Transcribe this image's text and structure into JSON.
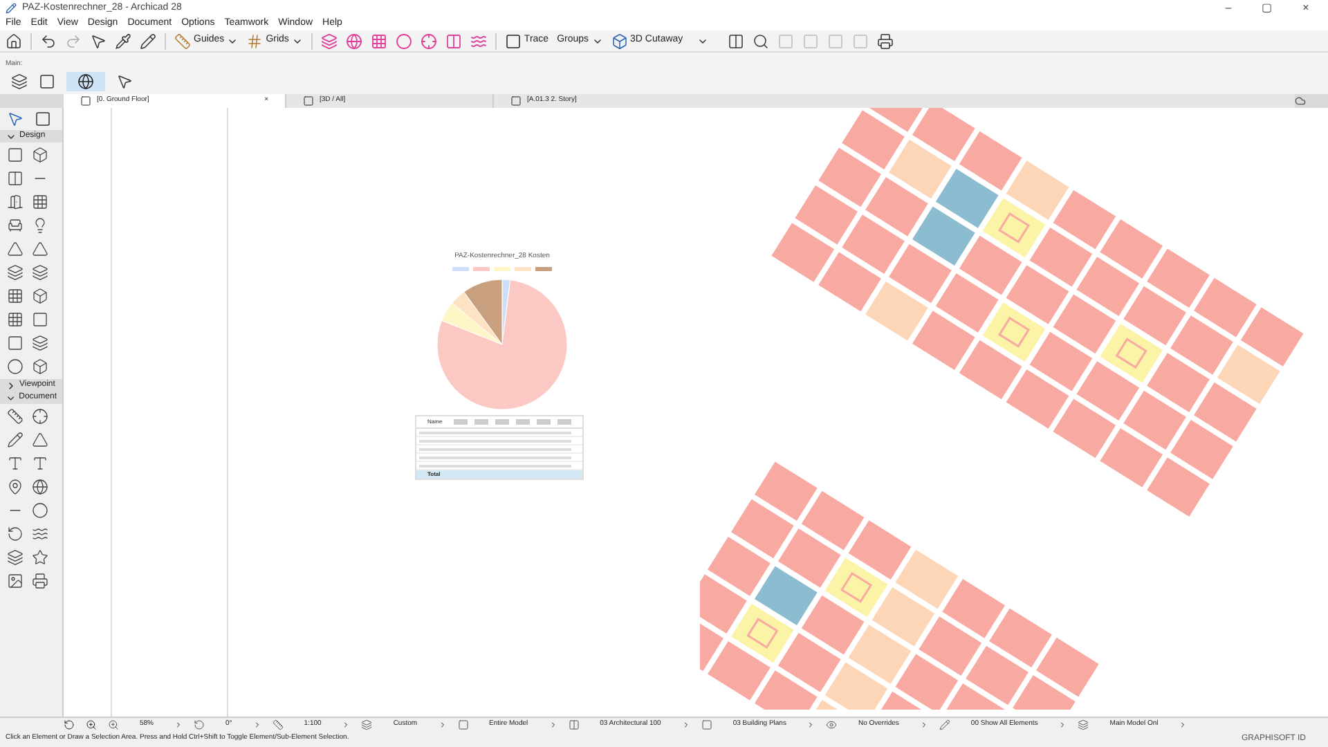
{
  "window": {
    "title": "PAZ-Kostenrechner_28 - Archicad 28",
    "controls": [
      "–",
      "▢",
      "×"
    ]
  },
  "menu": [
    "File",
    "Edit",
    "View",
    "Design",
    "Document",
    "Options",
    "Teamwork",
    "Window",
    "Help"
  ],
  "toolbar": {
    "dropdowns": [
      "Guides",
      "Grids",
      "Trace",
      "Groups",
      "3D Cutaway"
    ]
  },
  "main_label": "Main:",
  "tabs": [
    {
      "label": "[0. Ground Floor]",
      "selected": true,
      "close": "×"
    },
    {
      "label": "[3D / All]",
      "selected": false
    },
    {
      "label": "[A.01.3 2. Story]",
      "selected": false
    }
  ],
  "toolbox": {
    "sections": [
      {
        "title": "Design",
        "expanded": true
      },
      {
        "title": "Viewpoint",
        "expanded": false
      },
      {
        "title": "Document",
        "expanded": true
      }
    ]
  },
  "chart": {
    "title": "PAZ-Kostenrechner_28 Kosten"
  },
  "table": {
    "name_header": "Name",
    "total_label": "Total"
  },
  "status_bar": {
    "items": [
      "58%",
      "0°",
      "1:100",
      "Custom",
      "Entire Model",
      "03 Architectural 100",
      "03 Building Plans",
      "No Overrides",
      "00 Show All Elements",
      "Main Model Onl"
    ],
    "account": "GRAPHISOFT ID"
  },
  "prompt": "Click an Element or Draw a Selection Area. Press and Hold Ctrl+Shift to Toggle Element/Sub-Element Selection."
}
